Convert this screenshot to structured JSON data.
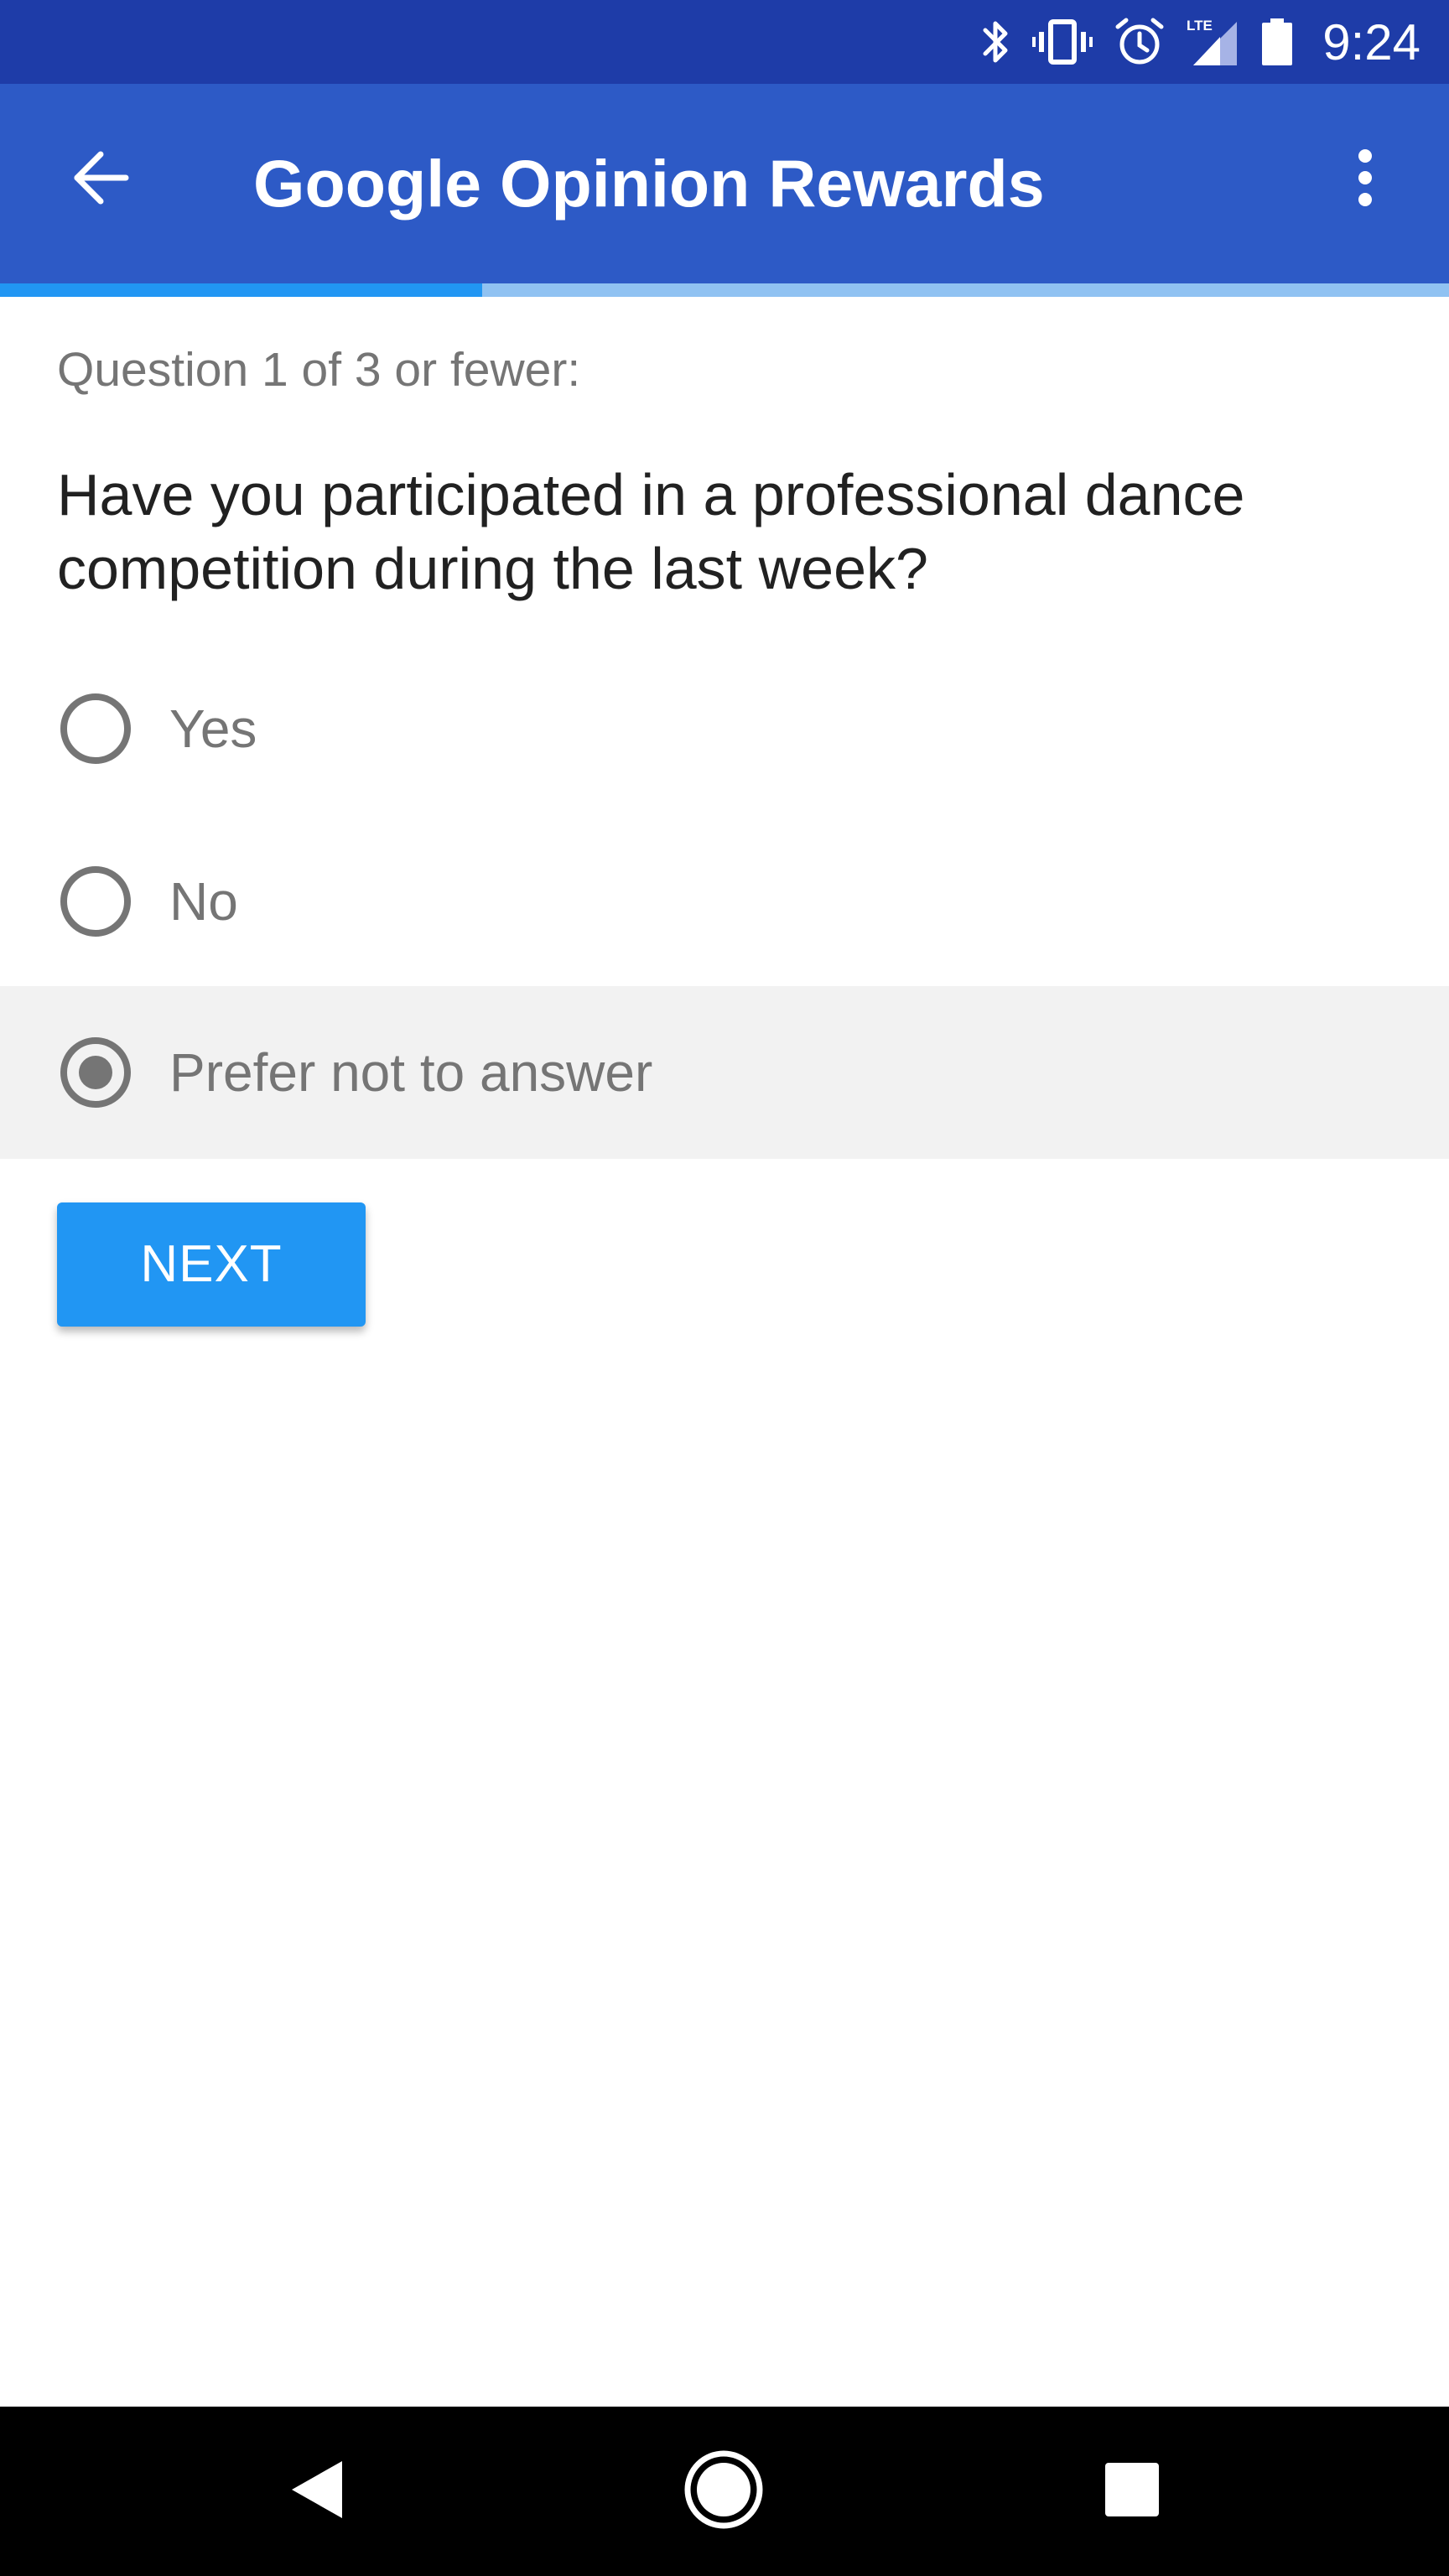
{
  "status_bar": {
    "time": "9:24",
    "icons": [
      "bluetooth-icon",
      "vibrate-icon",
      "alarm-icon",
      "lte-signal-icon",
      "battery-icon"
    ]
  },
  "app_bar": {
    "title": "Google Opinion Rewards",
    "back_icon": "arrow-back-icon",
    "menu_icon": "more-vertical-icon"
  },
  "progress": {
    "fraction": 0.333,
    "fill_color": "#2196f3",
    "track_color": "#90c2f2"
  },
  "survey": {
    "counter": "Question 1 of 3 or fewer:",
    "question": "Have you participated in a professional dance competition during the last week?",
    "options": [
      {
        "label": "Yes",
        "selected": false
      },
      {
        "label": "No",
        "selected": false
      },
      {
        "label": "Prefer not to answer",
        "selected": true
      }
    ],
    "next_label": "NEXT"
  },
  "nav_bar": {
    "icons": [
      "nav-back-icon",
      "nav-home-icon",
      "nav-recents-icon"
    ]
  },
  "colors": {
    "status_bar": "#1e3ca8",
    "app_bar": "#2d5ac6",
    "accent": "#2196f3"
  }
}
